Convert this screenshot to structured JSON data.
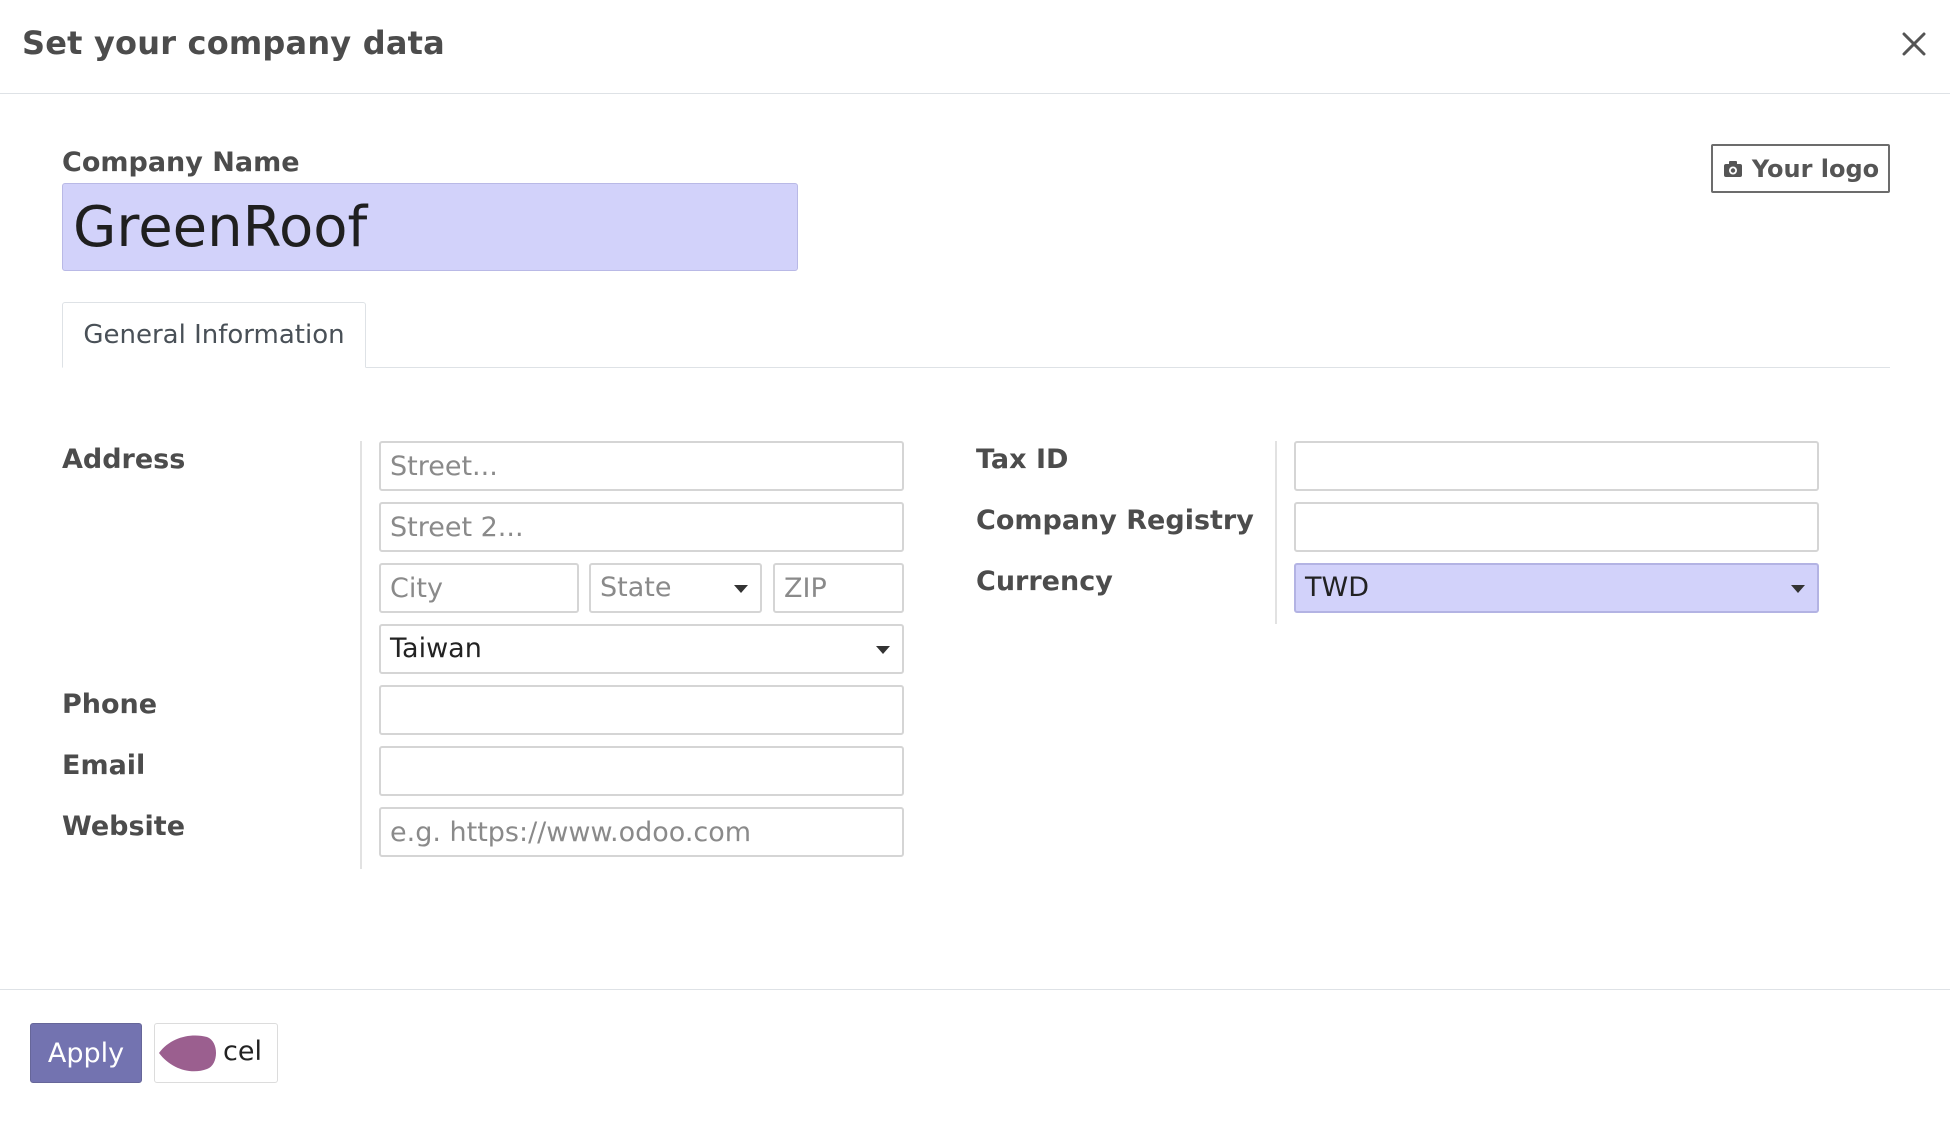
{
  "header": {
    "title": "Set your company data",
    "close_icon": "close-icon"
  },
  "company": {
    "label": "Company Name",
    "value": "GreenRoof",
    "logo_button": "Your logo",
    "logo_icon": "camera-icon"
  },
  "tabs": [
    {
      "label": "General Information",
      "active": true
    }
  ],
  "address": {
    "label": "Address",
    "street_placeholder": "Street...",
    "street2_placeholder": "Street 2...",
    "city_placeholder": "City",
    "state_placeholder": "State",
    "zip_placeholder": "ZIP",
    "country_value": "Taiwan"
  },
  "phone": {
    "label": "Phone",
    "value": ""
  },
  "email": {
    "label": "Email",
    "value": ""
  },
  "website": {
    "label": "Website",
    "placeholder": "e.g. https://www.odoo.com"
  },
  "tax_id": {
    "label": "Tax ID",
    "value": ""
  },
  "company_registry": {
    "label": "Company Registry",
    "value": ""
  },
  "currency": {
    "label": "Currency",
    "value": "TWD"
  },
  "footer": {
    "apply_label": "Apply",
    "cancel_label": "cel"
  },
  "colors": {
    "primary": "#7373b0",
    "highlight_field": "#d2d2fa"
  }
}
